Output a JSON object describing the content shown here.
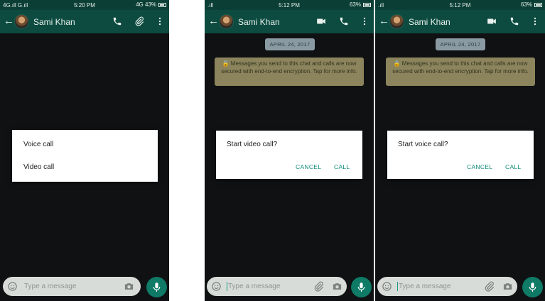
{
  "colors": {
    "statusbar": "#0b3f36",
    "appbar": "#0d4b40",
    "chat_background": "#0f1113",
    "accent": "#0e8a78",
    "mic_button": "#0f7a66"
  },
  "panels": [
    {
      "statusbar": {
        "left": "4G.ıll G.ıll",
        "time": "5:20 PM",
        "right": "4G 43%"
      },
      "header": {
        "contact_name": "Sami Khan",
        "icons": [
          "back-arrow-icon",
          "avatar",
          "phone-icon",
          "paperclip-icon",
          "more-vert-icon"
        ]
      },
      "call_menu": {
        "items": [
          "Voice call",
          "Video call"
        ]
      },
      "composer": {
        "placeholder": "Type a message",
        "icons": [
          "emoji-icon",
          "camera-icon",
          "mic-icon"
        ]
      }
    },
    {
      "statusbar": {
        "left": ".ıll",
        "time": "5:12 PM",
        "right": "63%"
      },
      "header": {
        "contact_name": "Sami Khan",
        "icons": [
          "back-arrow-icon",
          "avatar",
          "video-camera-icon",
          "phone-icon",
          "more-vert-icon"
        ]
      },
      "date_chip": "APRIL 24, 2017",
      "encryption_notice": "🔒 Messages you send to this chat and calls are now secured with end-to-end encryption. Tap for more info.",
      "dialog": {
        "title": "Start video call?",
        "cancel": "CANCEL",
        "confirm": "CALL"
      },
      "composer": {
        "placeholder": "Type a message",
        "icons": [
          "emoji-icon",
          "paperclip-icon",
          "camera-icon",
          "mic-icon"
        ]
      }
    },
    {
      "statusbar": {
        "left": ".ıll",
        "time": "5:12 PM",
        "right": "63%"
      },
      "header": {
        "contact_name": "Sami Khan",
        "icons": [
          "back-arrow-icon",
          "avatar",
          "video-camera-icon",
          "phone-icon",
          "more-vert-icon"
        ]
      },
      "date_chip": "APRIL 24, 2017",
      "encryption_notice": "🔒 Messages you send to this chat and calls are now secured with end-to-end encryption. Tap for more info.",
      "dialog": {
        "title": "Start voice call?",
        "cancel": "CANCEL",
        "confirm": "CALL"
      },
      "composer": {
        "placeholder": "Type a message",
        "icons": [
          "emoji-icon",
          "paperclip-icon",
          "camera-icon",
          "mic-icon"
        ]
      }
    }
  ]
}
